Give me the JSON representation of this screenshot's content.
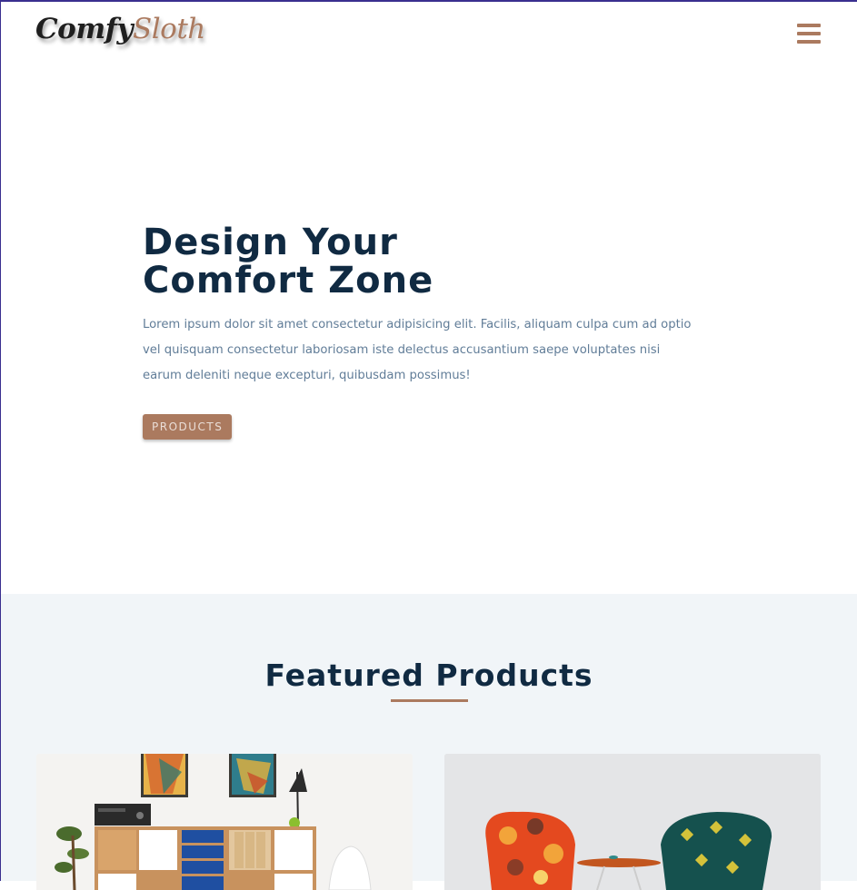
{
  "brand": {
    "part1": "Comfy",
    "part2": "Sloth"
  },
  "nav": {
    "menu_icon": "hamburger-menu-icon"
  },
  "hero": {
    "title_line1": "Design Your",
    "title_line2": "Comfort Zone",
    "text": "Lorem ipsum dolor sit amet consectetur adipisicing elit. Facilis, aliquam culpa cum ad optio vel quisquam consectetur laboriosam iste delectus accusantium saepe voluptates nisi earum deleniti neque excepturi, quibusdam possimus!",
    "button_label": "PRODUCTS"
  },
  "featured": {
    "title": "Featured Products"
  },
  "colors": {
    "brand": "#ab7a5f",
    "heading": "#102a42",
    "text": "#617d98",
    "section_bg": "#f1f5f8"
  }
}
